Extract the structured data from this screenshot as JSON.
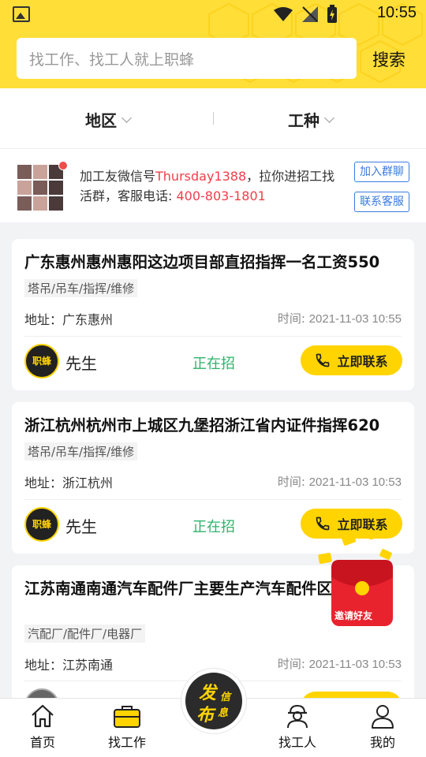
{
  "status_bar": {
    "time": "10:55"
  },
  "search": {
    "placeholder": "找工作、找工人就上职蜂",
    "button": "搜索"
  },
  "filters": {
    "region": "地区",
    "trade": "工种"
  },
  "notice": {
    "text_1": "加工友微信号",
    "wechat_id": "Thursday1388",
    "text_2": "，拉你进招工找活群，客服电话: ",
    "phone": "400-803-1801",
    "join_group": "加入群聊",
    "contact_service": "联系客服"
  },
  "jobs": [
    {
      "title": "广东惠州惠州惠阳这边项目部直招指挥一名工资550",
      "tags": "塔吊/吊车/指挥/维修",
      "address_label": "地址：",
      "address": "广东惠州",
      "time_label": "时间: ",
      "time": "2021-11-03 10:55",
      "logo_text": "职蜂",
      "poster": "先生",
      "status": "正在招",
      "action": "立即联系"
    },
    {
      "title": "浙江杭州杭州市上城区九堡招浙江省内证件指挥620",
      "tags": "塔吊/吊车/指挥/维修",
      "address_label": "地址：",
      "address": "浙江杭州",
      "time_label": "时间: ",
      "time": "2021-11-03 10:53",
      "logo_text": "职蜂",
      "poster": "先生",
      "status": "正在招",
      "action": "立即联系"
    },
    {
      "title": "江苏南通南通汽车配件厂主要生产汽车配件区金",
      "tags": "汽配厂/配件厂/电器厂",
      "address_label": "地址：",
      "address": "江苏南通",
      "time_label": "时间: ",
      "time": "2021-11-03 10:53"
    }
  ],
  "promo": {
    "label": "邀请好友"
  },
  "tabbar": {
    "home": "首页",
    "find_job": "找工作",
    "publish_big_1": "发",
    "publish_big_2": "布",
    "publish_small_1": "信",
    "publish_small_2": "息",
    "find_worker": "找工人",
    "mine": "我的"
  },
  "colors": {
    "brand_yellow": "#ffde38",
    "accent_red": "#ef3e4a",
    "status_green": "#2db36b",
    "link_blue": "#3a7be0"
  }
}
